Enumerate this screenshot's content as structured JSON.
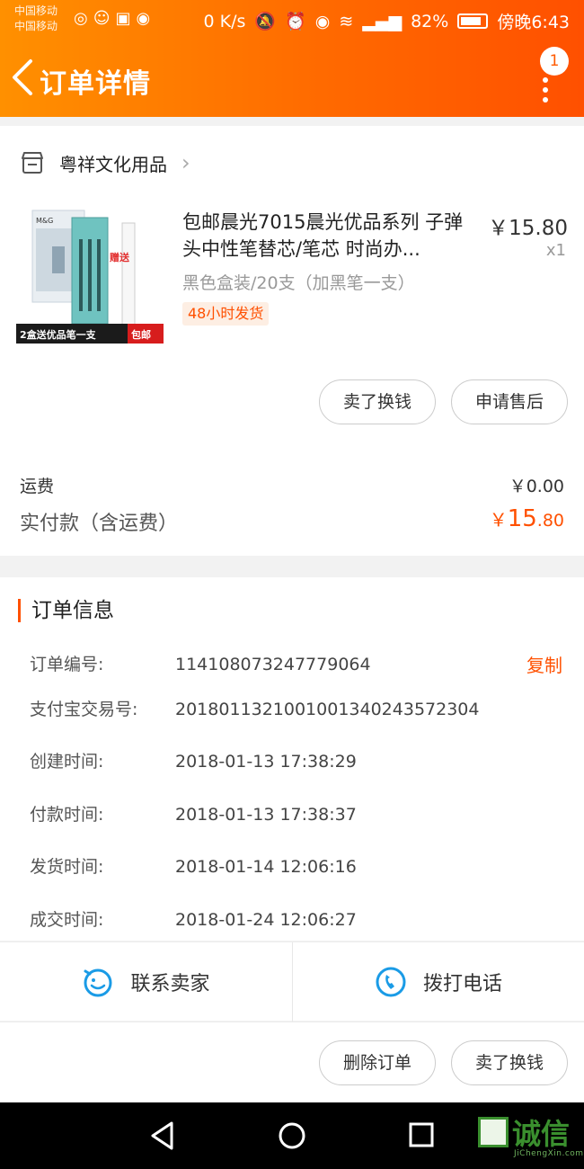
{
  "status_bar": {
    "carrier1": "中国移动",
    "carrier2": "中国移动",
    "speed": "0 K/s",
    "battery": "82%",
    "time": "傍晚6:43"
  },
  "header": {
    "title": "订单详情",
    "badge_count": "1"
  },
  "shop": {
    "name": "粤祥文化用品"
  },
  "product": {
    "name": "包邮晨光7015晨光优品系列 子弹头中性笔替芯/笔芯 时尚办...",
    "price": "￥15.80",
    "quantity": "x1",
    "sku": "黑色盒装/20支（加黑笔一支）",
    "tag": "48小时发货",
    "image_brand": "M&G",
    "image_gift": "赠送",
    "image_caption": "2盒送优品笔一支",
    "image_badge": "包邮"
  },
  "order_actions": {
    "sell_label": "卖了换钱",
    "after_sale_label": "申请售后"
  },
  "fees": {
    "shipping_label": "运费",
    "shipping_value": "￥0.00",
    "total_label": "实付款（含运费）",
    "total_yen": "￥",
    "total_int": "15",
    "total_dec": ".80"
  },
  "order_info": {
    "title": "订单信息",
    "copy_label": "复制",
    "rows": [
      {
        "key": "订单编号:",
        "value": "114108073247779064"
      },
      {
        "key": "支付宝交易号:",
        "value": "2018011321001001340243572304"
      },
      {
        "key": "创建时间:",
        "value": "2018-01-13 17:38:29"
      },
      {
        "key": "付款时间:",
        "value": "2018-01-13 17:38:37"
      },
      {
        "key": "发货时间:",
        "value": "2018-01-14 12:06:16"
      },
      {
        "key": "成交时间:",
        "value": "2018-01-24 12:06:27"
      }
    ]
  },
  "contact": {
    "seller_label": "联系卖家",
    "phone_label": "拨打电话"
  },
  "bottom_actions": {
    "delete_label": "删除订单",
    "sell_label": "卖了换钱"
  },
  "watermark": {
    "text": "诚信",
    "sub": "JiChengXin.com"
  },
  "colors": {
    "accent": "#ff5000",
    "header_start": "#ff9000",
    "header_end": "#ff5000"
  }
}
